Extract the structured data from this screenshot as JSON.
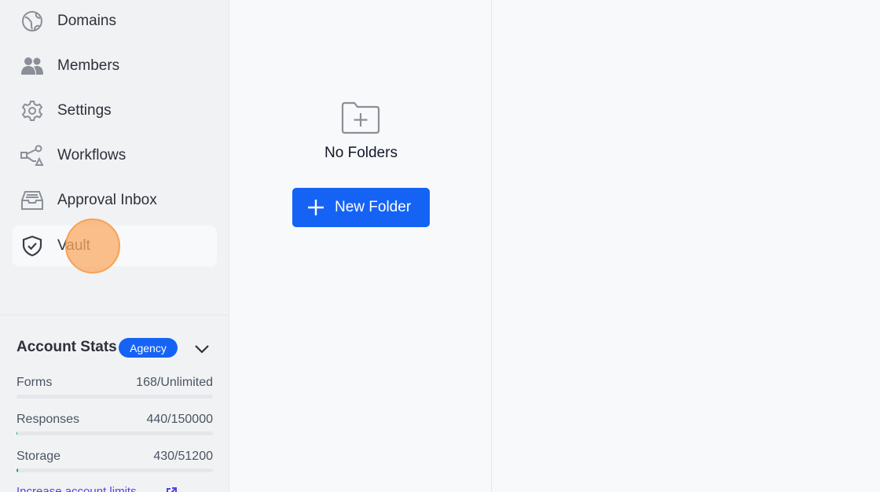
{
  "sidebar": {
    "items": [
      {
        "label": "Domains",
        "icon": "globe-icon"
      },
      {
        "label": "Members",
        "icon": "users-icon"
      },
      {
        "label": "Settings",
        "icon": "gear-icon"
      },
      {
        "label": "Workflows",
        "icon": "workflow-icon"
      },
      {
        "label": "Approval Inbox",
        "icon": "inbox-icon"
      },
      {
        "label": "Vault",
        "icon": "shield-check-icon",
        "active": true
      }
    ]
  },
  "account_stats": {
    "title": "Account Stats",
    "plan_badge": "Agency",
    "stats": [
      {
        "label": "Forms",
        "value": "168/Unlimited",
        "progress": 0
      },
      {
        "label": "Responses",
        "value": "440/150000",
        "progress": 0.003
      },
      {
        "label": "Storage",
        "value": "430/51200",
        "progress": 0.008
      }
    ],
    "limits_link": "Increase account limits"
  },
  "folders": {
    "empty_text": "No Folders",
    "new_folder_label": "New Folder"
  },
  "colors": {
    "accent": "#1563f5",
    "progress": "#16a34a",
    "link": "#4f46e5"
  }
}
